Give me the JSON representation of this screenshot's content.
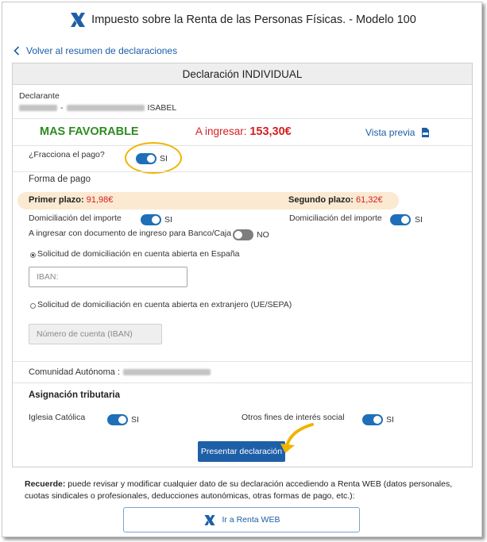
{
  "header": {
    "title": "Impuesto sobre la Renta de las Personas Físicas. - Modelo 100",
    "logo_icon": "aeat-logo-icon"
  },
  "nav": {
    "back_label": "Volver al resumen de declaraciones"
  },
  "panel": {
    "title": "Declaración INDIVIDUAL",
    "declarante_label": "Declarante",
    "declarante_name": "ISABEL",
    "favorable_label": "MAS FAVORABLE",
    "ingresar_label": "A ingresar:",
    "ingresar_amount": "153,30€",
    "vista_previa_label": "Vista previa",
    "fracciona_label": "¿Fracciona el pago?",
    "fracciona_value": "SI",
    "forma_pago_label": "Forma de pago",
    "primer_plazo_label": "Primer plazo:",
    "primer_plazo_value": "91,98€",
    "segundo_plazo_label": "Segundo plazo:",
    "segundo_plazo_value": "61,32€",
    "domiciliacion1_label": "Domiciliación del importe",
    "domiciliacion1_value": "SI",
    "domiciliacion2_label": "Domiciliación del importe",
    "domiciliacion2_value": "SI",
    "documento_label": "A ingresar con documento de ingreso para Banco/Caja",
    "documento_value": "NO",
    "radio_espana_label": "Solicitud de domiciliación en cuenta abierta en España",
    "iban_placeholder": "IBAN:",
    "radio_extranjero_label": "Solicitud de domiciliación en cuenta abierta en extranjero (UE/SEPA)",
    "cuenta_placeholder": "Número de cuenta (IBAN)",
    "comunidad_label": "Comunidad Autónoma :",
    "asignacion_title": "Asignación tributaria",
    "iglesia_label": "Iglesia Católica",
    "iglesia_value": "SI",
    "otros_fines_label": "Otros fines de interés social",
    "otros_fines_value": "SI",
    "presentar_label": "Presentar declaración"
  },
  "footer": {
    "recuerde_bold": "Recuerde:",
    "recuerde_text": " puede revisar y modificar cualquier dato de su declaración accediendo a Renta WEB (datos personales, cuotas sindicales o profesionales, deducciones autonómicas, otras formas de pago, etc.):",
    "renta_web_label": "Ir a Renta WEB"
  },
  "colors": {
    "brand_blue": "#1e5fa8",
    "toggle_on": "#1e6fb8",
    "toggle_off": "#7d7d7d",
    "favorable_green": "#2e8b22",
    "amount_red": "#d42020",
    "highlight_yellow": "#f0b400",
    "plazo_band": "#fbe9d2"
  }
}
